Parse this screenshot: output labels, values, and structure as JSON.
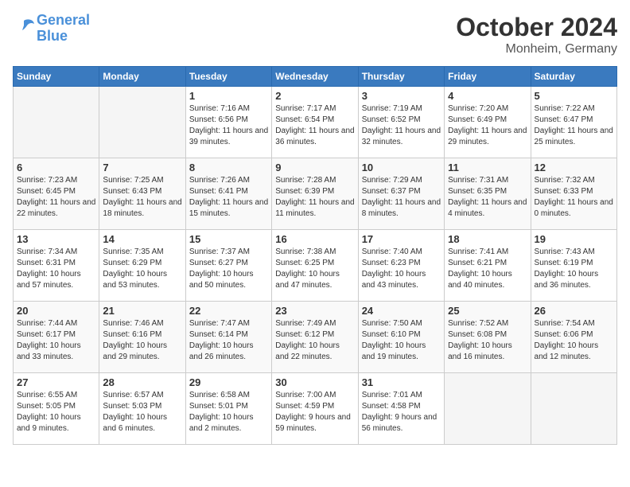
{
  "header": {
    "logo_line1": "General",
    "logo_line2": "Blue",
    "month": "October 2024",
    "location": "Monheim, Germany"
  },
  "weekdays": [
    "Sunday",
    "Monday",
    "Tuesday",
    "Wednesday",
    "Thursday",
    "Friday",
    "Saturday"
  ],
  "weeks": [
    [
      {
        "day": "",
        "info": ""
      },
      {
        "day": "",
        "info": ""
      },
      {
        "day": "1",
        "info": "Sunrise: 7:16 AM\nSunset: 6:56 PM\nDaylight: 11 hours and 39 minutes."
      },
      {
        "day": "2",
        "info": "Sunrise: 7:17 AM\nSunset: 6:54 PM\nDaylight: 11 hours and 36 minutes."
      },
      {
        "day": "3",
        "info": "Sunrise: 7:19 AM\nSunset: 6:52 PM\nDaylight: 11 hours and 32 minutes."
      },
      {
        "day": "4",
        "info": "Sunrise: 7:20 AM\nSunset: 6:49 PM\nDaylight: 11 hours and 29 minutes."
      },
      {
        "day": "5",
        "info": "Sunrise: 7:22 AM\nSunset: 6:47 PM\nDaylight: 11 hours and 25 minutes."
      }
    ],
    [
      {
        "day": "6",
        "info": "Sunrise: 7:23 AM\nSunset: 6:45 PM\nDaylight: 11 hours and 22 minutes."
      },
      {
        "day": "7",
        "info": "Sunrise: 7:25 AM\nSunset: 6:43 PM\nDaylight: 11 hours and 18 minutes."
      },
      {
        "day": "8",
        "info": "Sunrise: 7:26 AM\nSunset: 6:41 PM\nDaylight: 11 hours and 15 minutes."
      },
      {
        "day": "9",
        "info": "Sunrise: 7:28 AM\nSunset: 6:39 PM\nDaylight: 11 hours and 11 minutes."
      },
      {
        "day": "10",
        "info": "Sunrise: 7:29 AM\nSunset: 6:37 PM\nDaylight: 11 hours and 8 minutes."
      },
      {
        "day": "11",
        "info": "Sunrise: 7:31 AM\nSunset: 6:35 PM\nDaylight: 11 hours and 4 minutes."
      },
      {
        "day": "12",
        "info": "Sunrise: 7:32 AM\nSunset: 6:33 PM\nDaylight: 11 hours and 0 minutes."
      }
    ],
    [
      {
        "day": "13",
        "info": "Sunrise: 7:34 AM\nSunset: 6:31 PM\nDaylight: 10 hours and 57 minutes."
      },
      {
        "day": "14",
        "info": "Sunrise: 7:35 AM\nSunset: 6:29 PM\nDaylight: 10 hours and 53 minutes."
      },
      {
        "day": "15",
        "info": "Sunrise: 7:37 AM\nSunset: 6:27 PM\nDaylight: 10 hours and 50 minutes."
      },
      {
        "day": "16",
        "info": "Sunrise: 7:38 AM\nSunset: 6:25 PM\nDaylight: 10 hours and 47 minutes."
      },
      {
        "day": "17",
        "info": "Sunrise: 7:40 AM\nSunset: 6:23 PM\nDaylight: 10 hours and 43 minutes."
      },
      {
        "day": "18",
        "info": "Sunrise: 7:41 AM\nSunset: 6:21 PM\nDaylight: 10 hours and 40 minutes."
      },
      {
        "day": "19",
        "info": "Sunrise: 7:43 AM\nSunset: 6:19 PM\nDaylight: 10 hours and 36 minutes."
      }
    ],
    [
      {
        "day": "20",
        "info": "Sunrise: 7:44 AM\nSunset: 6:17 PM\nDaylight: 10 hours and 33 minutes."
      },
      {
        "day": "21",
        "info": "Sunrise: 7:46 AM\nSunset: 6:16 PM\nDaylight: 10 hours and 29 minutes."
      },
      {
        "day": "22",
        "info": "Sunrise: 7:47 AM\nSunset: 6:14 PM\nDaylight: 10 hours and 26 minutes."
      },
      {
        "day": "23",
        "info": "Sunrise: 7:49 AM\nSunset: 6:12 PM\nDaylight: 10 hours and 22 minutes."
      },
      {
        "day": "24",
        "info": "Sunrise: 7:50 AM\nSunset: 6:10 PM\nDaylight: 10 hours and 19 minutes."
      },
      {
        "day": "25",
        "info": "Sunrise: 7:52 AM\nSunset: 6:08 PM\nDaylight: 10 hours and 16 minutes."
      },
      {
        "day": "26",
        "info": "Sunrise: 7:54 AM\nSunset: 6:06 PM\nDaylight: 10 hours and 12 minutes."
      }
    ],
    [
      {
        "day": "27",
        "info": "Sunrise: 6:55 AM\nSunset: 5:05 PM\nDaylight: 10 hours and 9 minutes."
      },
      {
        "day": "28",
        "info": "Sunrise: 6:57 AM\nSunset: 5:03 PM\nDaylight: 10 hours and 6 minutes."
      },
      {
        "day": "29",
        "info": "Sunrise: 6:58 AM\nSunset: 5:01 PM\nDaylight: 10 hours and 2 minutes."
      },
      {
        "day": "30",
        "info": "Sunrise: 7:00 AM\nSunset: 4:59 PM\nDaylight: 9 hours and 59 minutes."
      },
      {
        "day": "31",
        "info": "Sunrise: 7:01 AM\nSunset: 4:58 PM\nDaylight: 9 hours and 56 minutes."
      },
      {
        "day": "",
        "info": ""
      },
      {
        "day": "",
        "info": ""
      }
    ]
  ]
}
